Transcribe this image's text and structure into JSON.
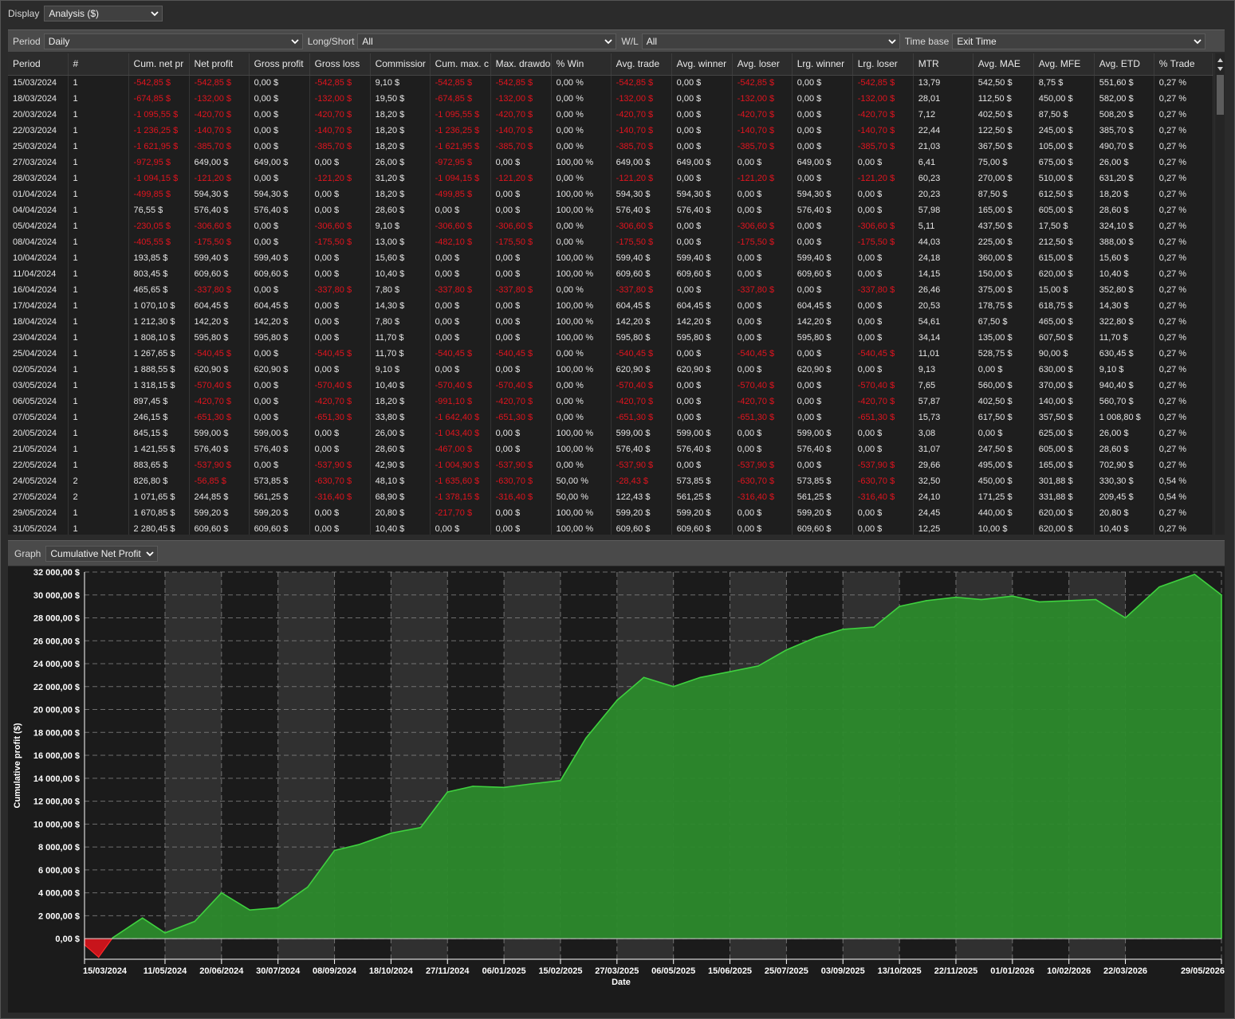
{
  "display": {
    "label": "Display",
    "value": "Analysis ($)",
    "chevron_icon": "chevron-down-icon"
  },
  "filters": {
    "period": {
      "label": "Period",
      "value": "Daily"
    },
    "long_short": {
      "label": "Long/Short",
      "value": "All"
    },
    "wl": {
      "label": "W/L",
      "value": "All"
    },
    "time_base": {
      "label": "Time base",
      "value": "Exit Time"
    }
  },
  "table": {
    "columns": [
      "Period",
      "#",
      "Cum. net pr",
      "Net profit",
      "Gross profit",
      "Gross loss",
      "Commissior",
      "Cum. max. c",
      "Max. drawdo",
      "% Win",
      "Avg. trade",
      "Avg. winner",
      "Avg. loser",
      "Lrg. winner",
      "Lrg. loser",
      "MTR",
      "Avg. MAE",
      "Avg. MFE",
      "Avg. ETD",
      "% Trade"
    ],
    "rows": [
      [
        "15/03/2024",
        "1",
        "-542,85 $",
        "-542,85 $",
        "0,00 $",
        "-542,85 $",
        "9,10 $",
        "-542,85 $",
        "-542,85 $",
        "0,00 %",
        "-542,85 $",
        "0,00 $",
        "-542,85 $",
        "0,00 $",
        "-542,85 $",
        "13,79",
        "542,50 $",
        "8,75 $",
        "551,60 $",
        "0,27 %"
      ],
      [
        "18/03/2024",
        "1",
        "-674,85 $",
        "-132,00 $",
        "0,00 $",
        "-132,00 $",
        "19,50 $",
        "-674,85 $",
        "-132,00 $",
        "0,00 %",
        "-132,00 $",
        "0,00 $",
        "-132,00 $",
        "0,00 $",
        "-132,00 $",
        "28,01",
        "112,50 $",
        "450,00 $",
        "582,00 $",
        "0,27 %"
      ],
      [
        "20/03/2024",
        "1",
        "-1 095,55 $",
        "-420,70 $",
        "0,00 $",
        "-420,70 $",
        "18,20 $",
        "-1 095,55 $",
        "-420,70 $",
        "0,00 %",
        "-420,70 $",
        "0,00 $",
        "-420,70 $",
        "0,00 $",
        "-420,70 $",
        "7,12",
        "402,50 $",
        "87,50 $",
        "508,20 $",
        "0,27 %"
      ],
      [
        "22/03/2024",
        "1",
        "-1 236,25 $",
        "-140,70 $",
        "0,00 $",
        "-140,70 $",
        "18,20 $",
        "-1 236,25 $",
        "-140,70 $",
        "0,00 %",
        "-140,70 $",
        "0,00 $",
        "-140,70 $",
        "0,00 $",
        "-140,70 $",
        "22,44",
        "122,50 $",
        "245,00 $",
        "385,70 $",
        "0,27 %"
      ],
      [
        "25/03/2024",
        "1",
        "-1 621,95 $",
        "-385,70 $",
        "0,00 $",
        "-385,70 $",
        "18,20 $",
        "-1 621,95 $",
        "-385,70 $",
        "0,00 %",
        "-385,70 $",
        "0,00 $",
        "-385,70 $",
        "0,00 $",
        "-385,70 $",
        "21,03",
        "367,50 $",
        "105,00 $",
        "490,70 $",
        "0,27 %"
      ],
      [
        "27/03/2024",
        "1",
        "-972,95 $",
        "649,00 $",
        "649,00 $",
        "0,00 $",
        "26,00 $",
        "-972,95 $",
        "0,00 $",
        "100,00 %",
        "649,00 $",
        "649,00 $",
        "0,00 $",
        "649,00 $",
        "0,00 $",
        "6,41",
        "75,00 $",
        "675,00 $",
        "26,00 $",
        "0,27 %"
      ],
      [
        "28/03/2024",
        "1",
        "-1 094,15 $",
        "-121,20 $",
        "0,00 $",
        "-121,20 $",
        "31,20 $",
        "-1 094,15 $",
        "-121,20 $",
        "0,00 %",
        "-121,20 $",
        "0,00 $",
        "-121,20 $",
        "0,00 $",
        "-121,20 $",
        "60,23",
        "270,00 $",
        "510,00 $",
        "631,20 $",
        "0,27 %"
      ],
      [
        "01/04/2024",
        "1",
        "-499,85 $",
        "594,30 $",
        "594,30 $",
        "0,00 $",
        "18,20 $",
        "-499,85 $",
        "0,00 $",
        "100,00 %",
        "594,30 $",
        "594,30 $",
        "0,00 $",
        "594,30 $",
        "0,00 $",
        "20,23",
        "87,50 $",
        "612,50 $",
        "18,20 $",
        "0,27 %"
      ],
      [
        "04/04/2024",
        "1",
        "76,55 $",
        "576,40 $",
        "576,40 $",
        "0,00 $",
        "28,60 $",
        "0,00 $",
        "0,00 $",
        "100,00 %",
        "576,40 $",
        "576,40 $",
        "0,00 $",
        "576,40 $",
        "0,00 $",
        "57,98",
        "165,00 $",
        "605,00 $",
        "28,60 $",
        "0,27 %"
      ],
      [
        "05/04/2024",
        "1",
        "-230,05 $",
        "-306,60 $",
        "0,00 $",
        "-306,60 $",
        "9,10 $",
        "-306,60 $",
        "-306,60 $",
        "0,00 %",
        "-306,60 $",
        "0,00 $",
        "-306,60 $",
        "0,00 $",
        "-306,60 $",
        "5,11",
        "437,50 $",
        "17,50 $",
        "324,10 $",
        "0,27 %"
      ],
      [
        "08/04/2024",
        "1",
        "-405,55 $",
        "-175,50 $",
        "0,00 $",
        "-175,50 $",
        "13,00 $",
        "-482,10 $",
        "-175,50 $",
        "0,00 %",
        "-175,50 $",
        "0,00 $",
        "-175,50 $",
        "0,00 $",
        "-175,50 $",
        "44,03",
        "225,00 $",
        "212,50 $",
        "388,00 $",
        "0,27 %"
      ],
      [
        "10/04/2024",
        "1",
        "193,85 $",
        "599,40 $",
        "599,40 $",
        "0,00 $",
        "15,60 $",
        "0,00 $",
        "0,00 $",
        "100,00 %",
        "599,40 $",
        "599,40 $",
        "0,00 $",
        "599,40 $",
        "0,00 $",
        "24,18",
        "360,00 $",
        "615,00 $",
        "15,60 $",
        "0,27 %"
      ],
      [
        "11/04/2024",
        "1",
        "803,45 $",
        "609,60 $",
        "609,60 $",
        "0,00 $",
        "10,40 $",
        "0,00 $",
        "0,00 $",
        "100,00 %",
        "609,60 $",
        "609,60 $",
        "0,00 $",
        "609,60 $",
        "0,00 $",
        "14,15",
        "150,00 $",
        "620,00 $",
        "10,40 $",
        "0,27 %"
      ],
      [
        "16/04/2024",
        "1",
        "465,65 $",
        "-337,80 $",
        "0,00 $",
        "-337,80 $",
        "7,80 $",
        "-337,80 $",
        "-337,80 $",
        "0,00 %",
        "-337,80 $",
        "0,00 $",
        "-337,80 $",
        "0,00 $",
        "-337,80 $",
        "26,46",
        "375,00 $",
        "15,00 $",
        "352,80 $",
        "0,27 %"
      ],
      [
        "17/04/2024",
        "1",
        "1 070,10 $",
        "604,45 $",
        "604,45 $",
        "0,00 $",
        "14,30 $",
        "0,00 $",
        "0,00 $",
        "100,00 %",
        "604,45 $",
        "604,45 $",
        "0,00 $",
        "604,45 $",
        "0,00 $",
        "20,53",
        "178,75 $",
        "618,75 $",
        "14,30 $",
        "0,27 %"
      ],
      [
        "18/04/2024",
        "1",
        "1 212,30 $",
        "142,20 $",
        "142,20 $",
        "0,00 $",
        "7,80 $",
        "0,00 $",
        "0,00 $",
        "100,00 %",
        "142,20 $",
        "142,20 $",
        "0,00 $",
        "142,20 $",
        "0,00 $",
        "54,61",
        "67,50 $",
        "465,00 $",
        "322,80 $",
        "0,27 %"
      ],
      [
        "23/04/2024",
        "1",
        "1 808,10 $",
        "595,80 $",
        "595,80 $",
        "0,00 $",
        "11,70 $",
        "0,00 $",
        "0,00 $",
        "100,00 %",
        "595,80 $",
        "595,80 $",
        "0,00 $",
        "595,80 $",
        "0,00 $",
        "34,14",
        "135,00 $",
        "607,50 $",
        "11,70 $",
        "0,27 %"
      ],
      [
        "25/04/2024",
        "1",
        "1 267,65 $",
        "-540,45 $",
        "0,00 $",
        "-540,45 $",
        "11,70 $",
        "-540,45 $",
        "-540,45 $",
        "0,00 %",
        "-540,45 $",
        "0,00 $",
        "-540,45 $",
        "0,00 $",
        "-540,45 $",
        "11,01",
        "528,75 $",
        "90,00 $",
        "630,45 $",
        "0,27 %"
      ],
      [
        "02/05/2024",
        "1",
        "1 888,55 $",
        "620,90 $",
        "620,90 $",
        "0,00 $",
        "9,10 $",
        "0,00 $",
        "0,00 $",
        "100,00 %",
        "620,90 $",
        "620,90 $",
        "0,00 $",
        "620,90 $",
        "0,00 $",
        "9,13",
        "0,00 $",
        "630,00 $",
        "9,10 $",
        "0,27 %"
      ],
      [
        "03/05/2024",
        "1",
        "1 318,15 $",
        "-570,40 $",
        "0,00 $",
        "-570,40 $",
        "10,40 $",
        "-570,40 $",
        "-570,40 $",
        "0,00 %",
        "-570,40 $",
        "0,00 $",
        "-570,40 $",
        "0,00 $",
        "-570,40 $",
        "7,65",
        "560,00 $",
        "370,00 $",
        "940,40 $",
        "0,27 %"
      ],
      [
        "06/05/2024",
        "1",
        "897,45 $",
        "-420,70 $",
        "0,00 $",
        "-420,70 $",
        "18,20 $",
        "-991,10 $",
        "-420,70 $",
        "0,00 %",
        "-420,70 $",
        "0,00 $",
        "-420,70 $",
        "0,00 $",
        "-420,70 $",
        "57,87",
        "402,50 $",
        "140,00 $",
        "560,70 $",
        "0,27 %"
      ],
      [
        "07/05/2024",
        "1",
        "246,15 $",
        "-651,30 $",
        "0,00 $",
        "-651,30 $",
        "33,80 $",
        "-1 642,40 $",
        "-651,30 $",
        "0,00 %",
        "-651,30 $",
        "0,00 $",
        "-651,30 $",
        "0,00 $",
        "-651,30 $",
        "15,73",
        "617,50 $",
        "357,50 $",
        "1 008,80 $",
        "0,27 %"
      ],
      [
        "20/05/2024",
        "1",
        "845,15 $",
        "599,00 $",
        "599,00 $",
        "0,00 $",
        "26,00 $",
        "-1 043,40 $",
        "0,00 $",
        "100,00 %",
        "599,00 $",
        "599,00 $",
        "0,00 $",
        "599,00 $",
        "0,00 $",
        "3,08",
        "0,00 $",
        "625,00 $",
        "26,00 $",
        "0,27 %"
      ],
      [
        "21/05/2024",
        "1",
        "1 421,55 $",
        "576,40 $",
        "576,40 $",
        "0,00 $",
        "28,60 $",
        "-467,00 $",
        "0,00 $",
        "100,00 %",
        "576,40 $",
        "576,40 $",
        "0,00 $",
        "576,40 $",
        "0,00 $",
        "31,07",
        "247,50 $",
        "605,00 $",
        "28,60 $",
        "0,27 %"
      ],
      [
        "22/05/2024",
        "1",
        "883,65 $",
        "-537,90 $",
        "0,00 $",
        "-537,90 $",
        "42,90 $",
        "-1 004,90 $",
        "-537,90 $",
        "0,00 %",
        "-537,90 $",
        "0,00 $",
        "-537,90 $",
        "0,00 $",
        "-537,90 $",
        "29,66",
        "495,00 $",
        "165,00 $",
        "702,90 $",
        "0,27 %"
      ],
      [
        "24/05/2024",
        "2",
        "826,80 $",
        "-56,85 $",
        "573,85 $",
        "-630,70 $",
        "48,10 $",
        "-1 635,60 $",
        "-630,70 $",
        "50,00 %",
        "-28,43 $",
        "573,85 $",
        "-630,70 $",
        "573,85 $",
        "-630,70 $",
        "32,50",
        "450,00 $",
        "301,88 $",
        "330,30 $",
        "0,54 %"
      ],
      [
        "27/05/2024",
        "2",
        "1 071,65 $",
        "244,85 $",
        "561,25 $",
        "-316,40 $",
        "68,90 $",
        "-1 378,15 $",
        "-316,40 $",
        "50,00 %",
        "122,43 $",
        "561,25 $",
        "-316,40 $",
        "561,25 $",
        "-316,40 $",
        "24,10",
        "171,25 $",
        "331,88 $",
        "209,45 $",
        "0,54 %"
      ],
      [
        "29/05/2024",
        "1",
        "1 670,85 $",
        "599,20 $",
        "599,20 $",
        "0,00 $",
        "20,80 $",
        "-217,70 $",
        "0,00 $",
        "100,00 %",
        "599,20 $",
        "599,20 $",
        "0,00 $",
        "599,20 $",
        "0,00 $",
        "24,45",
        "440,00 $",
        "620,00 $",
        "20,80 $",
        "0,27 %"
      ],
      [
        "31/05/2024",
        "1",
        "2 280,45 $",
        "609,60 $",
        "609,60 $",
        "0,00 $",
        "10,40 $",
        "0,00 $",
        "0,00 $",
        "100,00 %",
        "609,60 $",
        "609,60 $",
        "0,00 $",
        "609,60 $",
        "0,00 $",
        "12,25",
        "10,00 $",
        "620,00 $",
        "10,40 $",
        "0,27 %"
      ]
    ]
  },
  "graph": {
    "label": "Graph",
    "value": "Cumulative Net Profit"
  },
  "colors": {
    "negative": "#e0141e",
    "area_fill": "#2c8a2c",
    "line": "#3fd13f",
    "neg_area": "#c8141b",
    "band": "#303030"
  },
  "chart_data": {
    "type": "area",
    "xlabel": "Date",
    "ylabel": "Cumulative profit ($)",
    "ylim": [
      -1800,
      32000
    ],
    "y_ticks": [
      "32 000,00 $",
      "30 000,00 $",
      "28 000,00 $",
      "26 000,00 $",
      "24 000,00 $",
      "22 000,00 $",
      "20 000,00 $",
      "18 000,00 $",
      "16 000,00 $",
      "14 000,00 $",
      "12 000,00 $",
      "10 000,00 $",
      "8 000,00 $",
      "6 000,00 $",
      "4 000,00 $",
      "2 000,00 $",
      "0,00 $"
    ],
    "x_ticks": [
      "15/03/2024",
      "11/05/2024",
      "20/06/2024",
      "30/07/2024",
      "08/09/2024",
      "18/10/2024",
      "27/11/2024",
      "06/01/2025",
      "15/02/2025",
      "27/03/2025",
      "06/05/2025",
      "15/06/2025",
      "25/07/2025",
      "03/09/2025",
      "13/10/2025",
      "22/11/2025",
      "01/01/2026",
      "10/02/2026",
      "22/03/2026",
      "29/05/2026"
    ],
    "grid": true,
    "series": [
      {
        "x": [
          "15/03/2024",
          "25/03/2024",
          "04/04/2024",
          "25/04/2024",
          "11/05/2024",
          "01/06/2024",
          "20/06/2024",
          "10/07/2024",
          "30/07/2024",
          "20/08/2024",
          "08/09/2024",
          "25/09/2024",
          "18/10/2024",
          "08/11/2024",
          "27/11/2024",
          "15/12/2024",
          "06/01/2025",
          "25/01/2025",
          "15/02/2025",
          "05/03/2025",
          "27/03/2025",
          "15/04/2025",
          "06/05/2025",
          "25/05/2025",
          "15/06/2025",
          "05/07/2025",
          "25/07/2025",
          "15/08/2025",
          "03/09/2025",
          "25/09/2025",
          "13/10/2025",
          "01/11/2025",
          "22/11/2025",
          "10/12/2025",
          "01/01/2026",
          "20/01/2026",
          "10/02/2026",
          "01/03/2026",
          "22/03/2026",
          "15/04/2026",
          "10/05/2026",
          "29/05/2026"
        ],
        "y": [
          -540,
          -1620,
          80,
          1800,
          500,
          1500,
          4000,
          2500,
          2700,
          4500,
          7700,
          8200,
          9200,
          9700,
          12800,
          13300,
          13200,
          13500,
          13800,
          17500,
          20800,
          22800,
          22000,
          22800,
          23300,
          23800,
          25200,
          26300,
          27000,
          27200,
          29000,
          29500,
          29800,
          29600,
          29900,
          29400,
          29500,
          29600,
          28000,
          30700,
          31800,
          30000
        ]
      }
    ]
  }
}
